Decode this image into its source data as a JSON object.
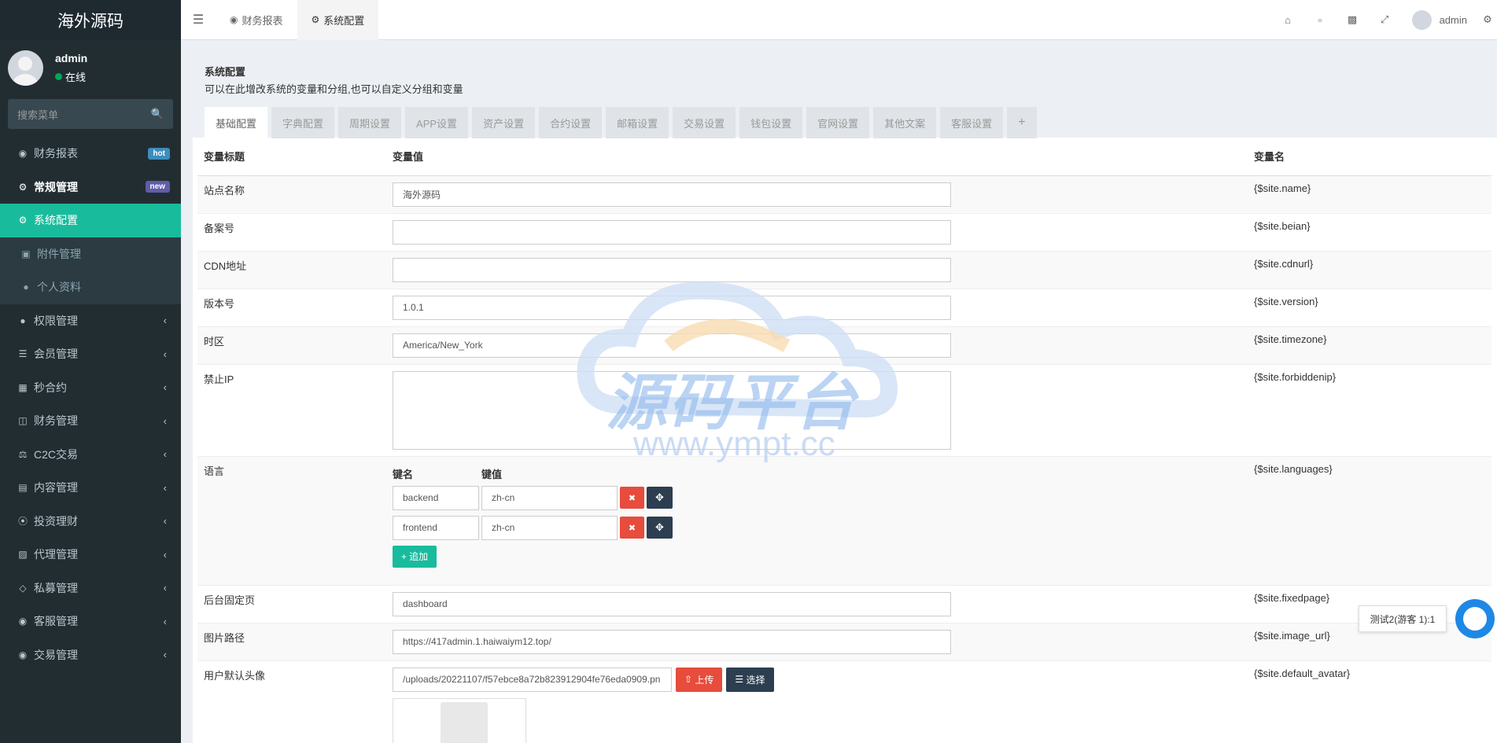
{
  "sidebar": {
    "logo": "海外源码",
    "user": {
      "name": "admin",
      "status": "在线"
    },
    "search_placeholder": "搜索菜单",
    "items": [
      {
        "label": "财务报表",
        "icon": "dashboard-icon",
        "badge": "hot",
        "badge_color": "#3c8dbc"
      },
      {
        "label": "常规管理",
        "icon": "cogs-icon",
        "badge": "new",
        "badge_color": "#605ca8"
      },
      {
        "label": "系统配置",
        "icon": "cog-icon"
      },
      {
        "label": "附件管理",
        "icon": "image-icon"
      },
      {
        "label": "个人资料",
        "icon": "user-icon"
      },
      {
        "label": "权限管理",
        "icon": "group-icon"
      },
      {
        "label": "会员管理",
        "icon": "list-icon"
      },
      {
        "label": "秒合约",
        "icon": "calendar-icon"
      },
      {
        "label": "财务管理",
        "icon": "database-icon"
      },
      {
        "label": "C2C交易",
        "icon": "balance-icon"
      },
      {
        "label": "内容管理",
        "icon": "file-icon"
      },
      {
        "label": "投资理财",
        "icon": "compass-icon"
      },
      {
        "label": "代理管理",
        "icon": "briefcase-icon"
      },
      {
        "label": "私募管理",
        "icon": "diamond-icon"
      },
      {
        "label": "客服管理",
        "icon": "comment-icon"
      },
      {
        "label": "交易管理",
        "icon": "eye-icon"
      }
    ]
  },
  "topbar": {
    "tabs": [
      {
        "label": "财务报表",
        "icon": "dashboard-icon"
      },
      {
        "label": "系统配置",
        "icon": "cog-icon"
      }
    ],
    "user": "admin"
  },
  "page": {
    "title": "系统配置",
    "subtitle": "可以在此增改系统的变量和分组,也可以自定义分组和变量",
    "tabs": [
      "基础配置",
      "字典配置",
      "周期设置",
      "APP设置",
      "资产设置",
      "合约设置",
      "邮箱设置",
      "交易设置",
      "钱包设置",
      "官网设置",
      "其他文案",
      "客服设置"
    ],
    "add_tab": "+",
    "table_headers": {
      "title": "变量标题",
      "value": "变量值",
      "name": "变量名"
    },
    "rows": {
      "sitename": {
        "title": "站点名称",
        "value": "海外源码",
        "var": "{$site.name}"
      },
      "beian": {
        "title": "备案号",
        "value": "",
        "var": "{$site.beian}"
      },
      "cdn": {
        "title": "CDN地址",
        "value": "",
        "var": "{$site.cdnurl}"
      },
      "version": {
        "title": "版本号",
        "value": "1.0.1",
        "var": "{$site.version}"
      },
      "timezone": {
        "title": "时区",
        "value": "America/New_York",
        "var": "{$site.timezone}"
      },
      "forbiddenip": {
        "title": "禁止IP",
        "value": "",
        "var": "{$site.forbiddenip}"
      },
      "languages": {
        "title": "语言",
        "key_header": "键名",
        "val_header": "键值",
        "pairs": [
          {
            "k": "backend",
            "v": "zh-cn"
          },
          {
            "k": "frontend",
            "v": "zh-cn"
          }
        ],
        "add_label": "追加",
        "var": "{$site.languages}"
      },
      "fixedpage": {
        "title": "后台固定页",
        "value": "dashboard",
        "var": "{$site.fixedpage}"
      },
      "image_url": {
        "title": "图片路径",
        "value": "https://417admin.1.haiwaiym12.top/",
        "var": "{$site.image_url}"
      },
      "avatar": {
        "title": "用户默认头像",
        "value": "/uploads/20221107/f57ebce8a72b823912904fe76eda0909.pn",
        "upload_label": "上传",
        "select_label": "选择",
        "var": "{$site.default_avatar}"
      }
    }
  },
  "watermark": {
    "text": "源码平台",
    "url": "www.ympt.cc"
  },
  "chat": {
    "tip": "测试2(游客 1):1"
  }
}
